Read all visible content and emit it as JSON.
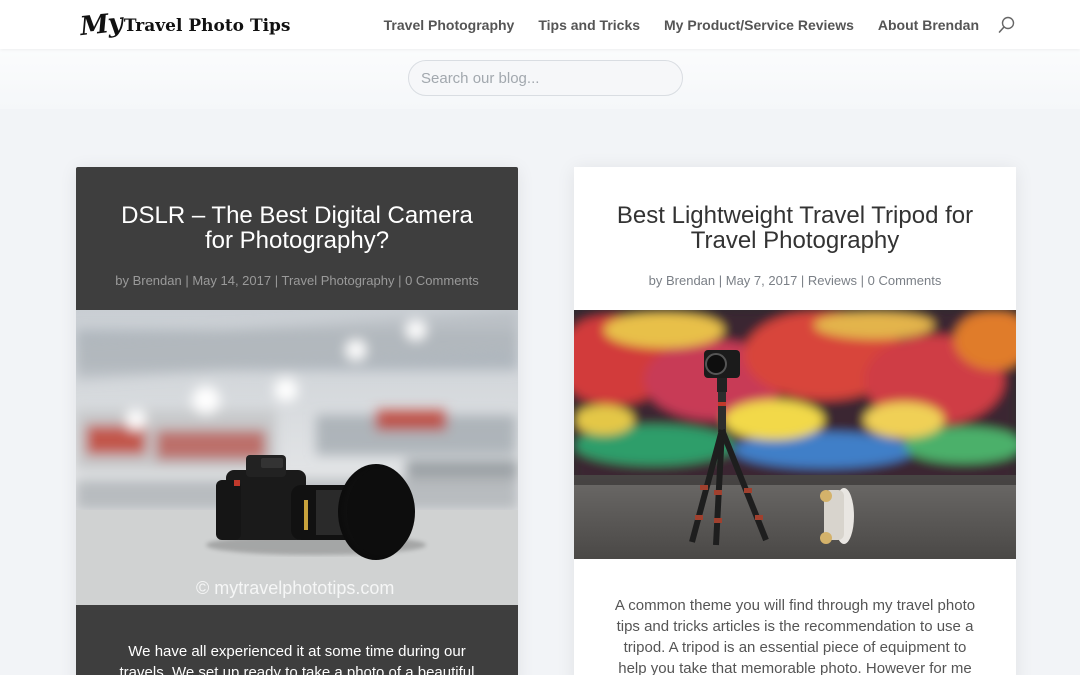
{
  "header": {
    "logo_my": "My",
    "logo_rest": "Travel Photo Tips",
    "nav": [
      {
        "label": "Travel Photography"
      },
      {
        "label": "Tips and Tricks"
      },
      {
        "label": "My Product/Service Reviews"
      },
      {
        "label": "About Brendan"
      }
    ],
    "search_icon": "search-icon"
  },
  "search": {
    "placeholder": "Search our blog..."
  },
  "posts": [
    {
      "title": "DSLR – The Best Digital Camera for Photography?",
      "meta": {
        "by": "by ",
        "author": "Brendan",
        "sep1": " | ",
        "date": "May 14, 2017",
        "sep2": " | ",
        "category": "Travel Photography",
        "sep3": " | ",
        "comments": "0 Comments"
      },
      "image_watermark": "© mytravelphototips.com",
      "excerpt": "We have all experienced it at some time during our travels.  We set up ready to take a photo of a beautiful"
    },
    {
      "title": "Best Lightweight Travel Tripod for Travel Photography",
      "meta": {
        "by": "by ",
        "author": "Brendan",
        "sep1": " | ",
        "date": "May 7, 2017",
        "sep2": " | ",
        "category": "Reviews",
        "sep3": " | ",
        "comments": "0 Comments"
      },
      "excerpt": "A common theme you will find through my travel photo tips and tricks articles is the recommendation to use a tripod.  A tripod is an essential piece of equipment to help you take that memorable photo. However for me"
    }
  ],
  "colors": {
    "page_bg": "#f2f4f7",
    "dark_card": "#3e3e3e",
    "nav_text": "#555555",
    "meta_text": "#9a9a9a"
  }
}
